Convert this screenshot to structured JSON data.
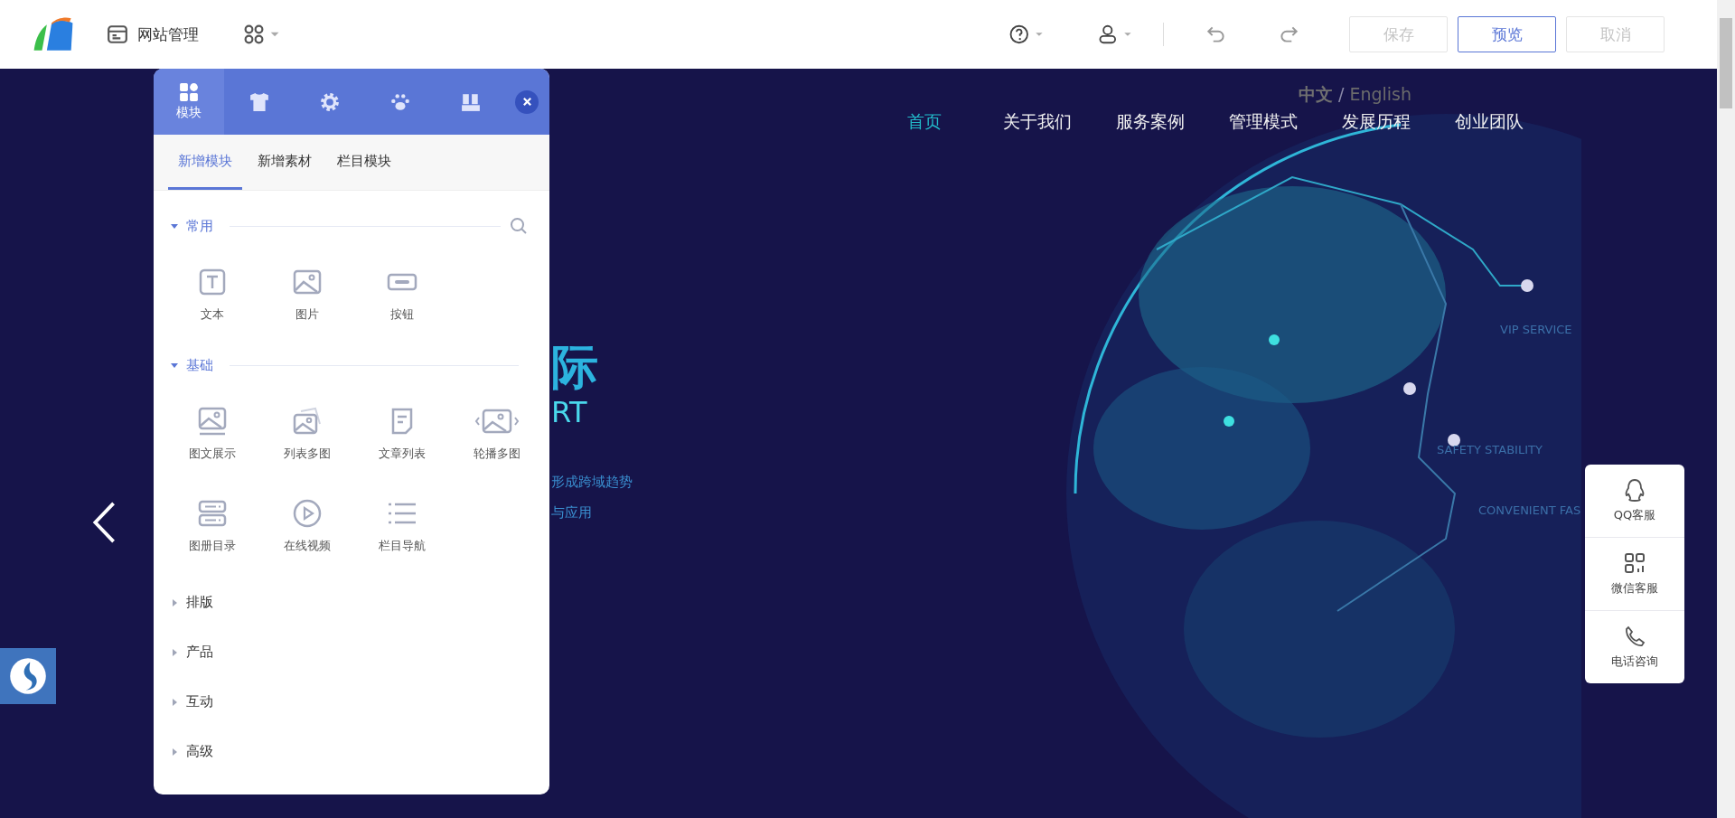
{
  "toolbar": {
    "title": "网站管理",
    "buttons": [
      {
        "label": "保存",
        "disabled": true
      },
      {
        "label": "预览",
        "disabled": false
      },
      {
        "label": "取消",
        "disabled": true
      }
    ]
  },
  "site": {
    "languages": [
      {
        "label": "中文",
        "selected": true
      },
      {
        "label": "English",
        "selected": false
      }
    ],
    "language_separator": "/",
    "nav": [
      {
        "label": "首页",
        "selected": true
      },
      {
        "label": "关于我们",
        "selected": false
      },
      {
        "label": "服务案例",
        "selected": false
      },
      {
        "label": "管理模式",
        "selected": false
      },
      {
        "label": "发展历程",
        "selected": false
      },
      {
        "label": "创业团队",
        "selected": false
      }
    ],
    "hero": {
      "heading": "际",
      "subheading": "RT",
      "lines": [
        "形成跨域趋势",
        "与应用"
      ]
    },
    "globe_labels": [
      "VIP SERVICE",
      "SAFETY STABILITY",
      "CONVENIENT FAS"
    ],
    "contact": [
      "QQ客服",
      "微信客服",
      "电话咨询"
    ]
  },
  "panel": {
    "icon_tabs": [
      {
        "label": "模块",
        "selected": true
      },
      {
        "selected": false
      },
      {
        "selected": false
      },
      {
        "selected": false
      },
      {
        "selected": false
      }
    ],
    "tabs": [
      {
        "label": "新增模块",
        "selected": true
      },
      {
        "label": "新增素材",
        "selected": false
      },
      {
        "label": "栏目模块",
        "selected": false
      }
    ],
    "sections": [
      {
        "title": "常用",
        "expanded": true,
        "items": [
          "文本",
          "图片",
          "按钮"
        ]
      },
      {
        "title": "基础",
        "expanded": true,
        "items": [
          "图文展示",
          "列表多图",
          "文章列表",
          "轮播多图",
          "图册目录",
          "在线视频",
          "栏目导航"
        ]
      },
      {
        "title": "排版",
        "expanded": false
      },
      {
        "title": "产品",
        "expanded": false
      },
      {
        "title": "互动",
        "expanded": false
      },
      {
        "title": "高级",
        "expanded": false
      }
    ]
  }
}
